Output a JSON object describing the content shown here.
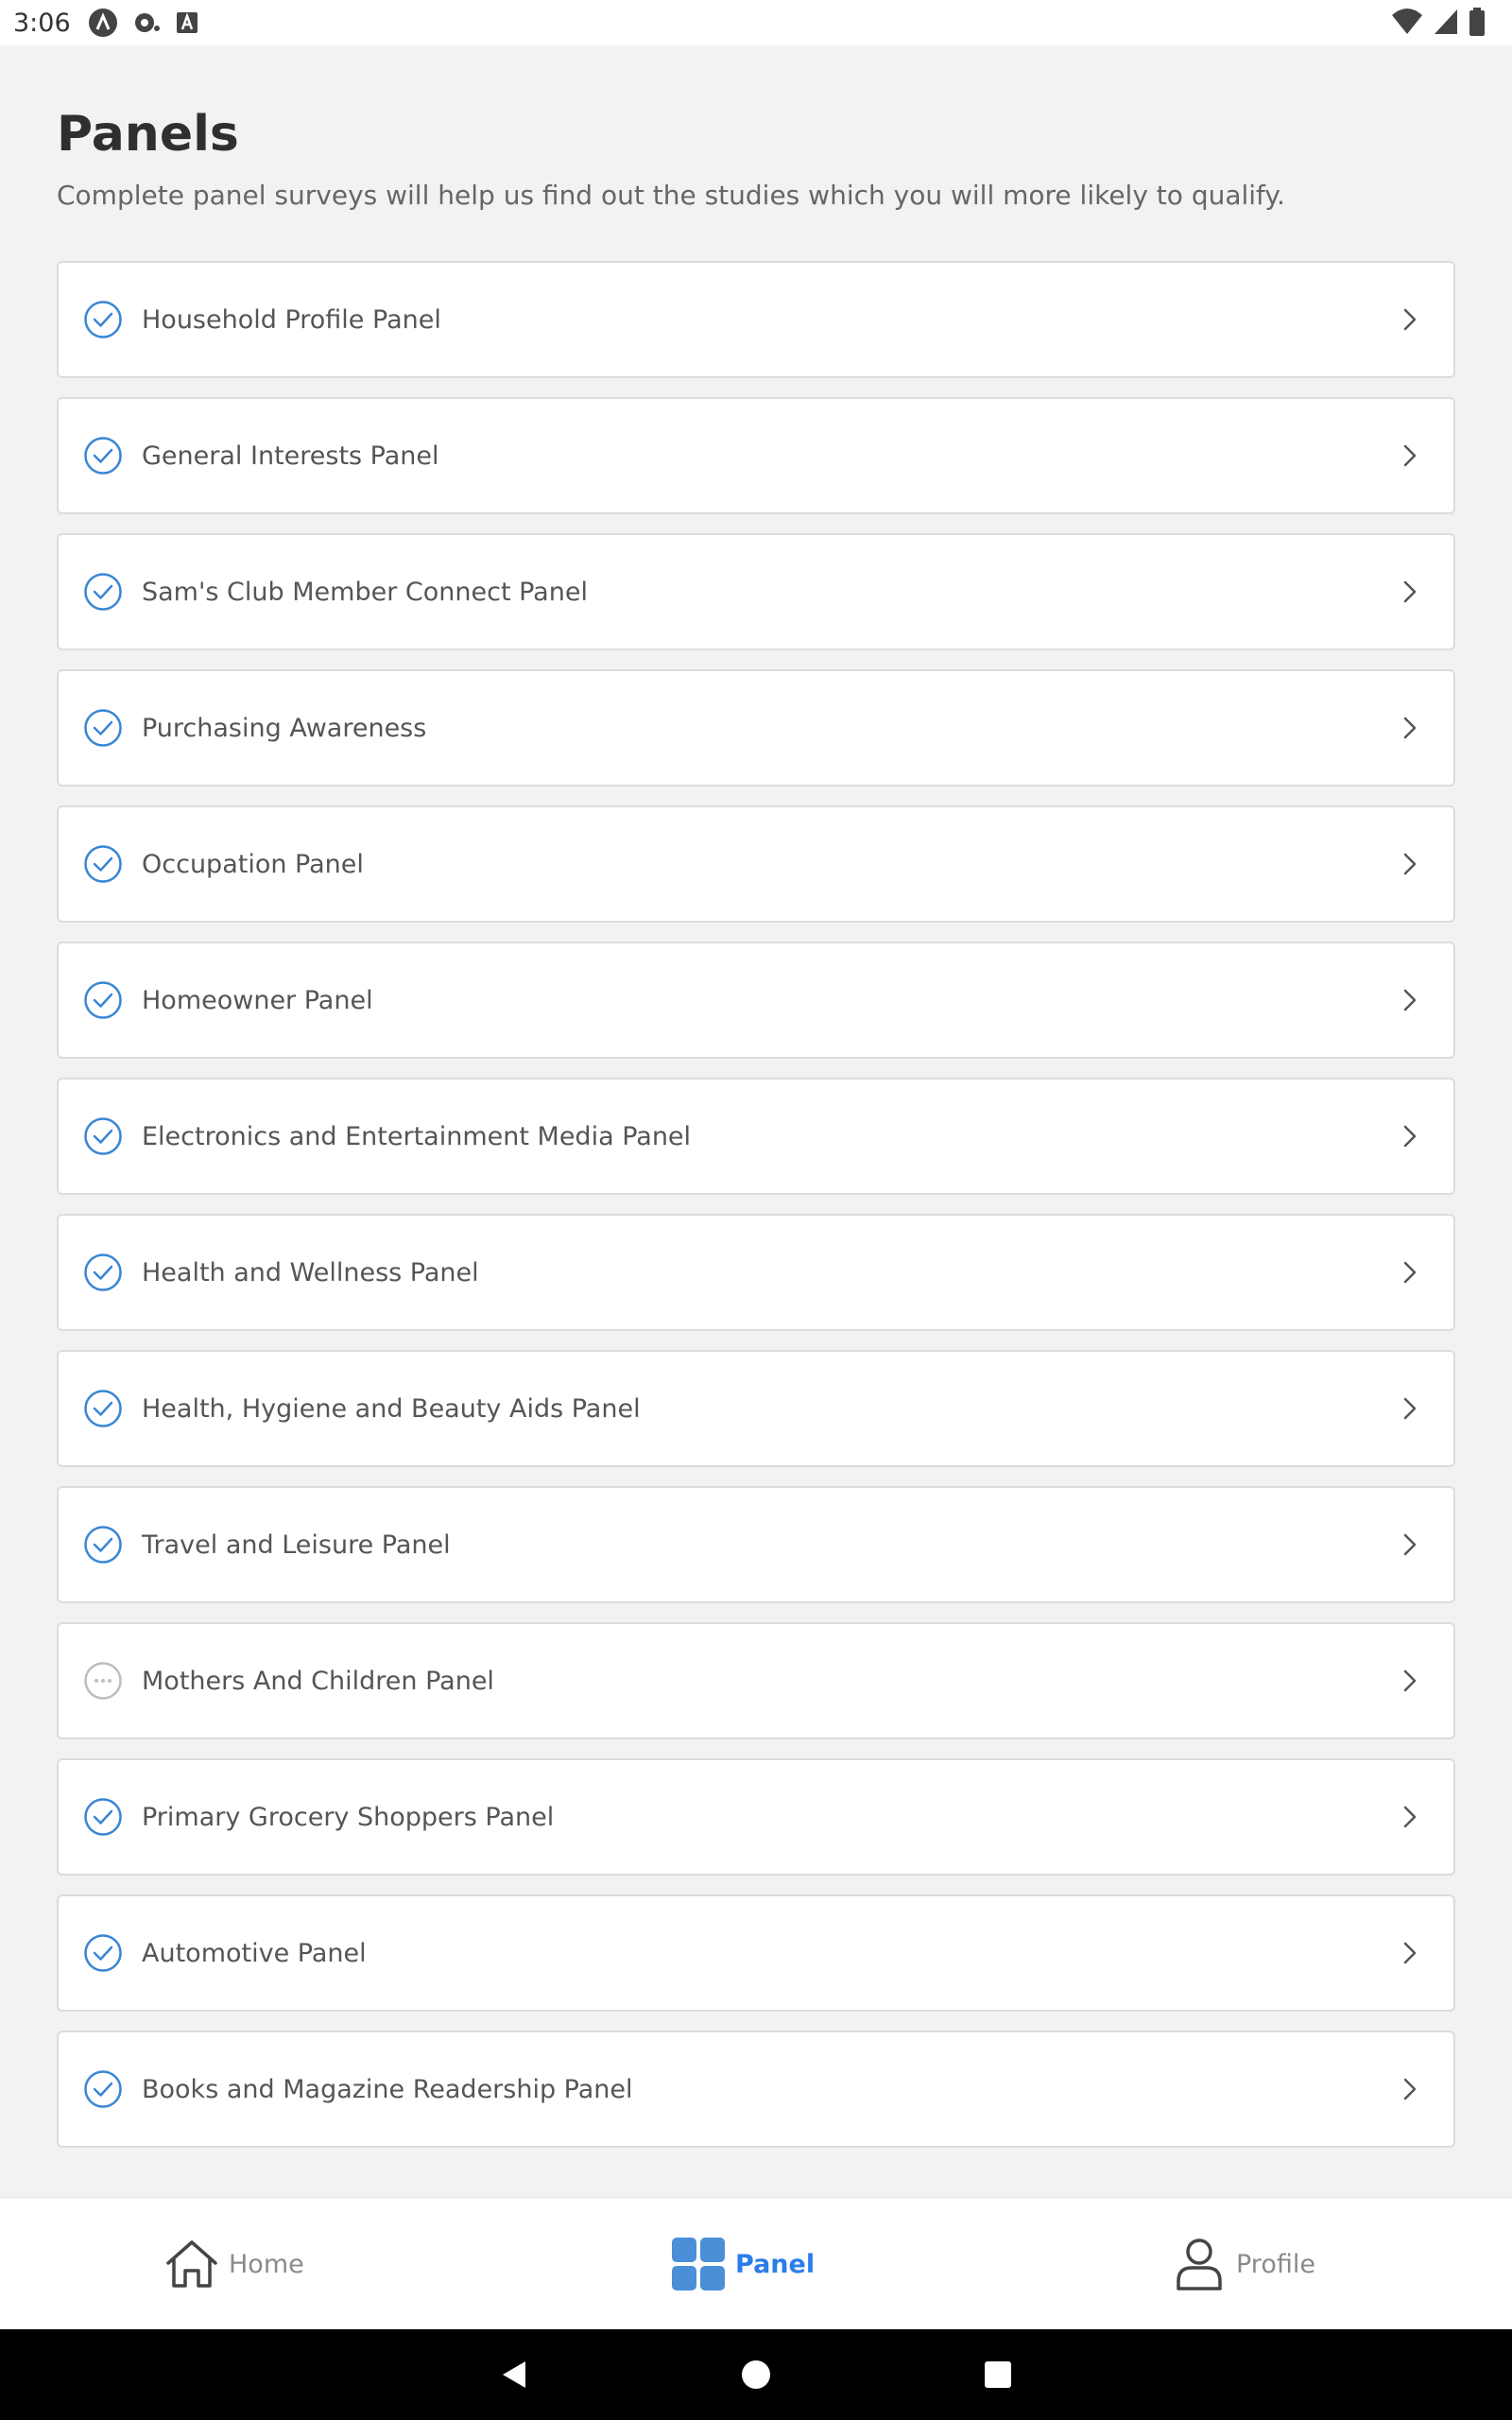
{
  "status_bar": {
    "time": "3:06",
    "left_icons": [
      "app-a-icon",
      "sync-icon",
      "font-a-icon"
    ],
    "right_icons": [
      "wifi-icon",
      "signal-icon",
      "battery-icon"
    ]
  },
  "header": {
    "title": "Panels",
    "subtitle": "Complete panel surveys will help us find out the studies which you will more likely to qualify."
  },
  "panels": [
    {
      "label": "Household Profile Panel",
      "status": "completed"
    },
    {
      "label": "General Interests Panel",
      "status": "completed"
    },
    {
      "label": "Sam's Club Member Connect Panel",
      "status": "completed"
    },
    {
      "label": "Purchasing Awareness",
      "status": "completed"
    },
    {
      "label": "Occupation Panel",
      "status": "completed"
    },
    {
      "label": "Homeowner Panel",
      "status": "completed"
    },
    {
      "label": "Electronics and Entertainment Media Panel",
      "status": "completed"
    },
    {
      "label": "Health and Wellness Panel",
      "status": "completed"
    },
    {
      "label": "Health, Hygiene and Beauty Aids Panel",
      "status": "completed"
    },
    {
      "label": "Travel and Leisure Panel",
      "status": "completed"
    },
    {
      "label": "Mothers And Children Panel",
      "status": "pending"
    },
    {
      "label": "Primary Grocery Shoppers Panel",
      "status": "completed"
    },
    {
      "label": "Automotive Panel",
      "status": "completed"
    },
    {
      "label": "Books and Magazine Readership Panel",
      "status": "completed"
    }
  ],
  "bottom_nav": {
    "home_label": "Home",
    "panel_label": "Panel",
    "profile_label": "Profile",
    "active": "Panel"
  },
  "colors": {
    "accent": "#2b7de9",
    "check": "#3a86d4",
    "pending": "#bdbdbd",
    "background": "#f2f2f2"
  }
}
